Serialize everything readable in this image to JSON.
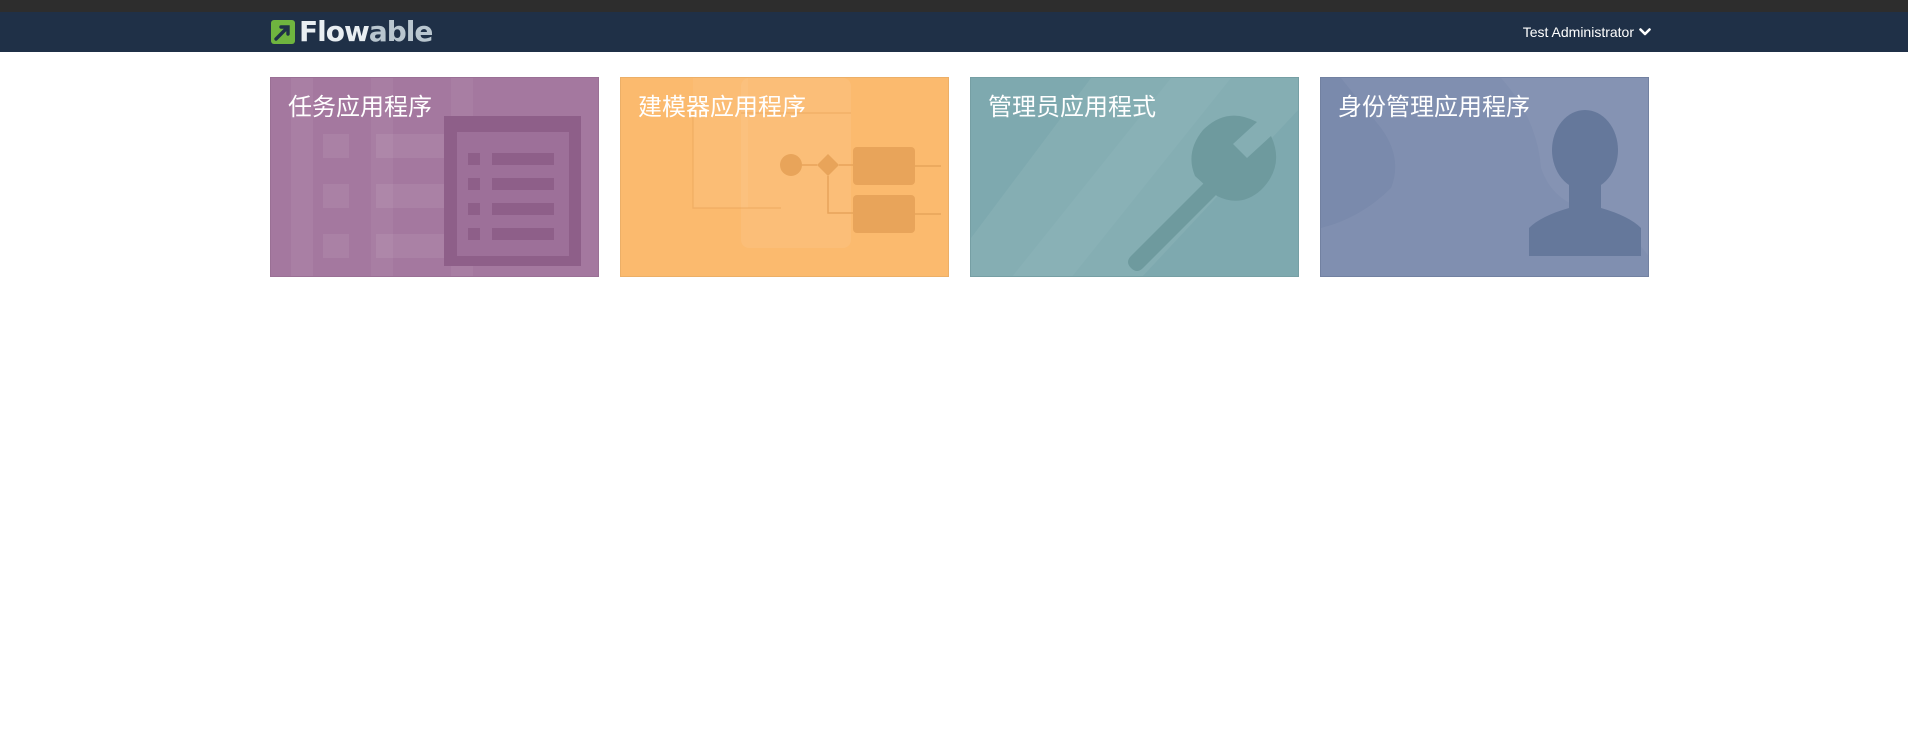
{
  "app": {
    "logo_text_main": "Flo",
    "logo_text_w": "w",
    "logo_text_rest": "able",
    "brand_colors": {
      "navbar": "#1f3047",
      "logo_green": "#6fb43f"
    }
  },
  "header": {
    "user_name": "Test Administrator",
    "user_menu_icon": "chevron-down-icon"
  },
  "tiles": [
    {
      "title": "任务应用程序",
      "icon": "task-list-icon",
      "color": "#a4789f"
    },
    {
      "title": "建模器应用程序",
      "icon": "process-diagram-icon",
      "color": "#fbba6e"
    },
    {
      "title": "管理员应用程式",
      "icon": "wrench-icon",
      "color": "#7ea9af"
    },
    {
      "title": "身份管理应用程序",
      "icon": "user-silhouette-icon",
      "color": "#7a8aac"
    }
  ]
}
